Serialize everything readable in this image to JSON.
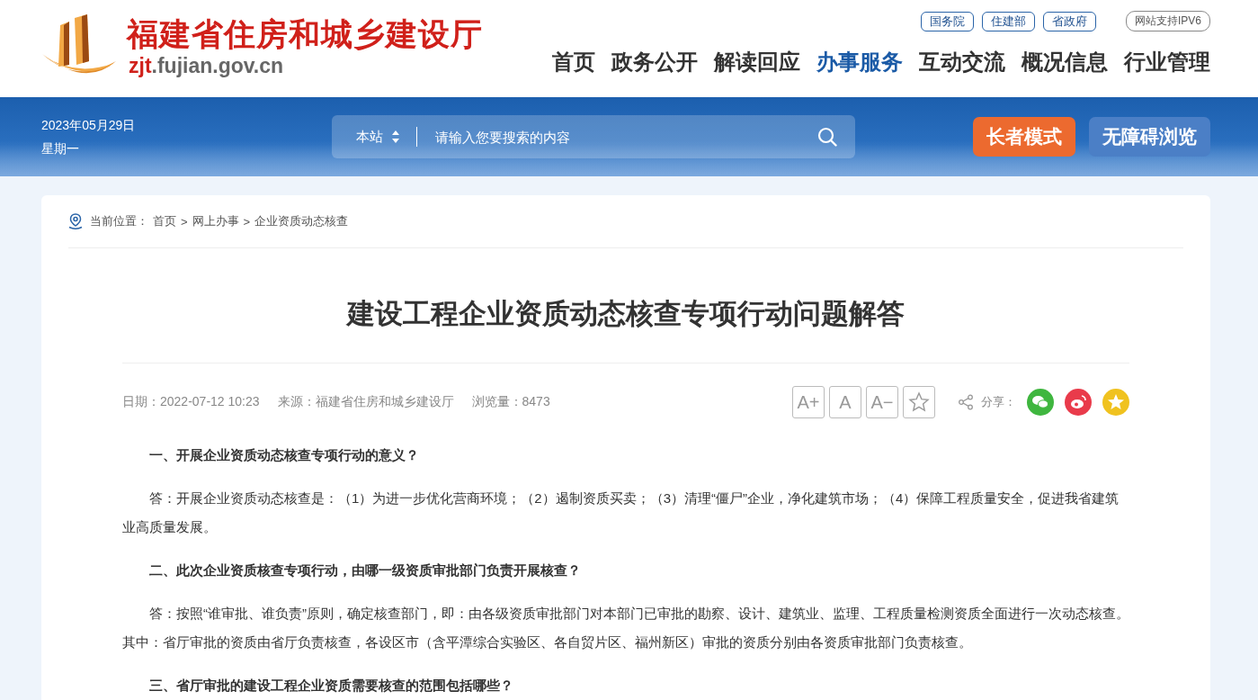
{
  "site": {
    "title": "福建省住房和城乡建设厅",
    "domain_prefix": "zjt",
    "domain_rest": ".fujian.gov.cn"
  },
  "top_links": [
    "国务院",
    "住建部",
    "省政府"
  ],
  "ipv6_badge": "网站支持IPV6",
  "nav": [
    {
      "label": "首页",
      "selected": false
    },
    {
      "label": "政务公开",
      "selected": false
    },
    {
      "label": "解读回应",
      "selected": false
    },
    {
      "label": "办事服务",
      "selected": true
    },
    {
      "label": "互动交流",
      "selected": false
    },
    {
      "label": "概况信息",
      "selected": false
    },
    {
      "label": "行业管理",
      "selected": false
    }
  ],
  "date": "2023年05月29日",
  "weekday": "星期一",
  "search": {
    "scope": "本站",
    "placeholder": "请输入您要搜索的内容"
  },
  "mode_buttons": [
    {
      "label": "长者模式",
      "kind": "elder"
    },
    {
      "label": "无障碍浏览",
      "kind": "accessible"
    }
  ],
  "breadcrumb": {
    "label": "当前位置：",
    "crumbs": [
      "首页",
      "网上办事",
      "企业资质动态核查"
    ],
    "separators": [
      ">",
      ">"
    ]
  },
  "article": {
    "title": "建设工程企业资质动态核查专项行动问题解答",
    "meta": [
      "日期：2022-07-12 10:23",
      "来源：福建省住房和城乡建设厅",
      "浏览量：8473"
    ],
    "font_buttons": [
      "A+",
      "A",
      "A−"
    ],
    "share_label": "分享：",
    "paragraphs": [
      {
        "kind": "question",
        "text": "一、开展企业资质动态核查专项行动的意义？"
      },
      {
        "kind": "answer",
        "text": "答：开展企业资质动态核查是：（1）为进一步优化营商环境；（2）遏制资质买卖；（3）清理“僵尸”企业，净化建筑市场；（4）保障工程质量安全，促进我省建筑业高质量发展。"
      },
      {
        "kind": "question",
        "text": "二、此次企业资质核查专项行动，由哪一级资质审批部门负责开展核查？"
      },
      {
        "kind": "answer",
        "text": "答：按照“谁审批、谁负责”原则，确定核查部门，即：由各级资质审批部门对本部门已审批的勘察、设计、建筑业、监理、工程质量检测资质全面进行一次动态核查。其中：省厅审批的资质由省厅负责核查，各设区市（含平潭综合实验区、各自贸片区、福州新区）审批的资质分别由各资质审批部门负责核查。"
      },
      {
        "kind": "question",
        "text": "三、省厅审批的建设工程企业资质需要核查的范围包括哪些？"
      }
    ]
  }
}
